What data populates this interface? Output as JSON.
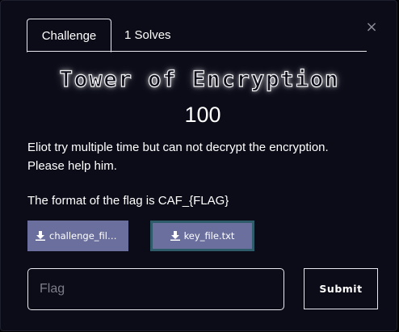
{
  "modal": {
    "close_symbol": "×",
    "tabs": [
      {
        "label": "Challenge",
        "active": true
      },
      {
        "label": "1 Solves",
        "active": false
      }
    ],
    "challenge": {
      "title": "Tower of Encryption",
      "points": "100",
      "description_line1": "Eliot try multiple time but can not decrypt the encryption.",
      "description_line2": "Please help him.",
      "flag_format": "The format of the flag is CAF_{FLAG}"
    },
    "files": [
      {
        "label": "challenge_file.txt",
        "icon": "download-icon"
      },
      {
        "label": "key_file.txt",
        "icon": "download-icon"
      }
    ],
    "flag_input": {
      "placeholder": "Flag",
      "value": ""
    },
    "submit_label": "Submit"
  },
  "colors": {
    "background": "#0b0c18",
    "file_button": "#6b6f9d",
    "focus_border": "#2f5c6a",
    "text": "#ffffff"
  }
}
